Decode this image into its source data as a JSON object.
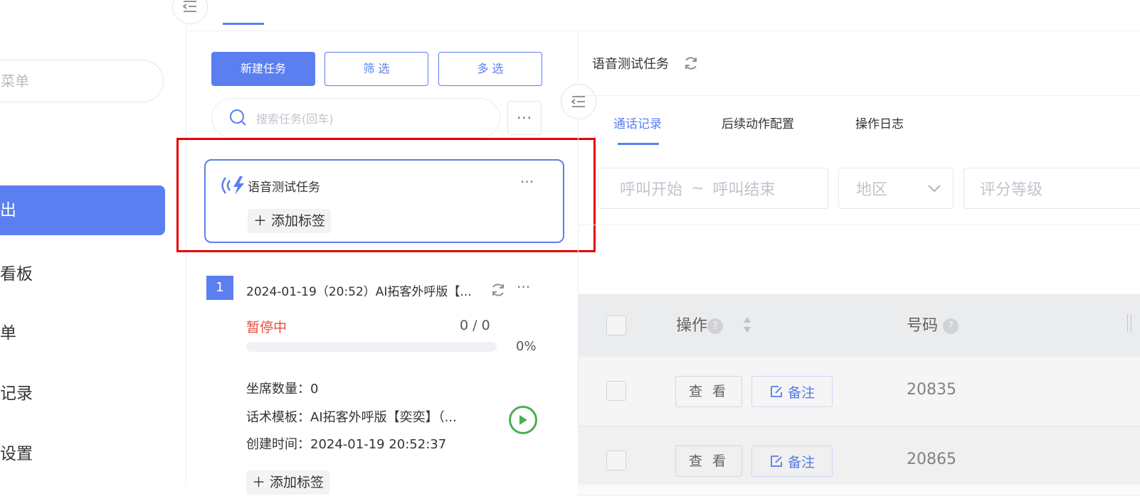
{
  "sidebar": {
    "search_placeholder": "菜单",
    "items": [
      {
        "label": "出",
        "active": true
      },
      {
        "label": "看板"
      },
      {
        "label": "单"
      },
      {
        "label": "记录"
      },
      {
        "label": "设置"
      }
    ]
  },
  "toolbar": {
    "new_task_label": "新建任务",
    "filter_label": "筛 选",
    "multi_select_label": "多 选",
    "search_placeholder": "搜索任务(回车)"
  },
  "selected_task": {
    "name": "语音测试任务",
    "add_tag_label": "添加标签"
  },
  "task_item": {
    "index": "1",
    "title": "2024-01-19（20:52）AI拓客外呼版【...",
    "status": "暂停中",
    "count": "0 / 0",
    "progress_percent": "0%",
    "progress_value": 0,
    "seats": "坐席数量：0",
    "template": "话术模板：AI拓客外呼版【奕奕】（...",
    "created": "创建时间：2024-01-19 20:52:37",
    "add_tag_label": "添加标签"
  },
  "detail": {
    "title": "语音测试任务",
    "tabs": [
      {
        "label": "通话记录",
        "active": true
      },
      {
        "label": "后续动作配置"
      },
      {
        "label": "操作日志"
      }
    ],
    "filters": {
      "call_start": "呼叫开始",
      "range_sep": "~",
      "call_end": "呼叫结束",
      "region": "地区",
      "score_level": "评分等级"
    },
    "table": {
      "col_action": "操作",
      "col_number": "号码",
      "view_label": "查 看",
      "note_label": "备注",
      "rows": [
        {
          "number": "20835"
        },
        {
          "number": "20865"
        }
      ]
    }
  },
  "colors": {
    "accent": "#5b7ef0",
    "status_paused": "#e74c3c",
    "highlight_box": "#e30000",
    "play": "#4caf50"
  }
}
